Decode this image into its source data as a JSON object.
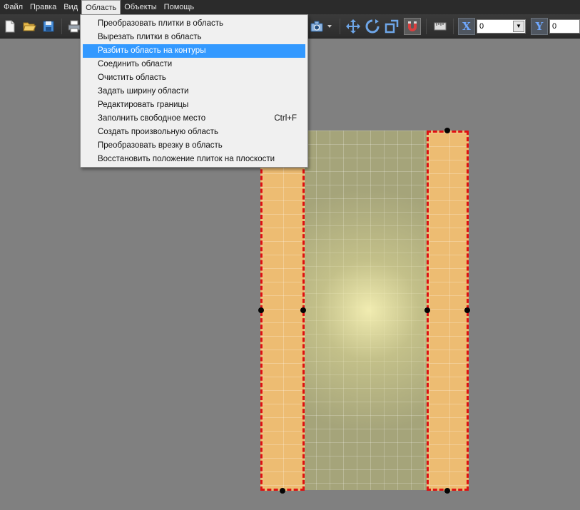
{
  "menubar": {
    "items": [
      "Файл",
      "Правка",
      "Вид",
      "Область",
      "Объекты",
      "Помощь"
    ],
    "open_index": 3
  },
  "toolbar": {
    "x_label": "X",
    "y_label": "Y",
    "x_value": "0",
    "y_value": "0"
  },
  "dropdown": {
    "items": [
      {
        "label": "Преобразовать плитки в область",
        "shortcut": ""
      },
      {
        "label": "Вырезать плитки в область",
        "shortcut": ""
      },
      {
        "label": "Разбить область на контуры",
        "shortcut": "",
        "highlighted": true
      },
      {
        "label": "Соединить области",
        "shortcut": ""
      },
      {
        "label": "Очистить область",
        "shortcut": ""
      },
      {
        "label": "Задать ширину области",
        "shortcut": ""
      },
      {
        "label": "Редактировать границы",
        "shortcut": ""
      },
      {
        "label": "Заполнить свободное место",
        "shortcut": "Ctrl+F"
      },
      {
        "label": "Создать произвольную область",
        "shortcut": ""
      },
      {
        "label": "Преобразовать врезку в область",
        "shortcut": ""
      },
      {
        "label": "Восстановить положение плиток на плоскости",
        "shortcut": ""
      }
    ]
  },
  "colors": {
    "accent_highlight": "#3399ff",
    "selection_border": "#e01010",
    "area_fill": "#edbc72",
    "tile_base": "#a5a47a"
  }
}
